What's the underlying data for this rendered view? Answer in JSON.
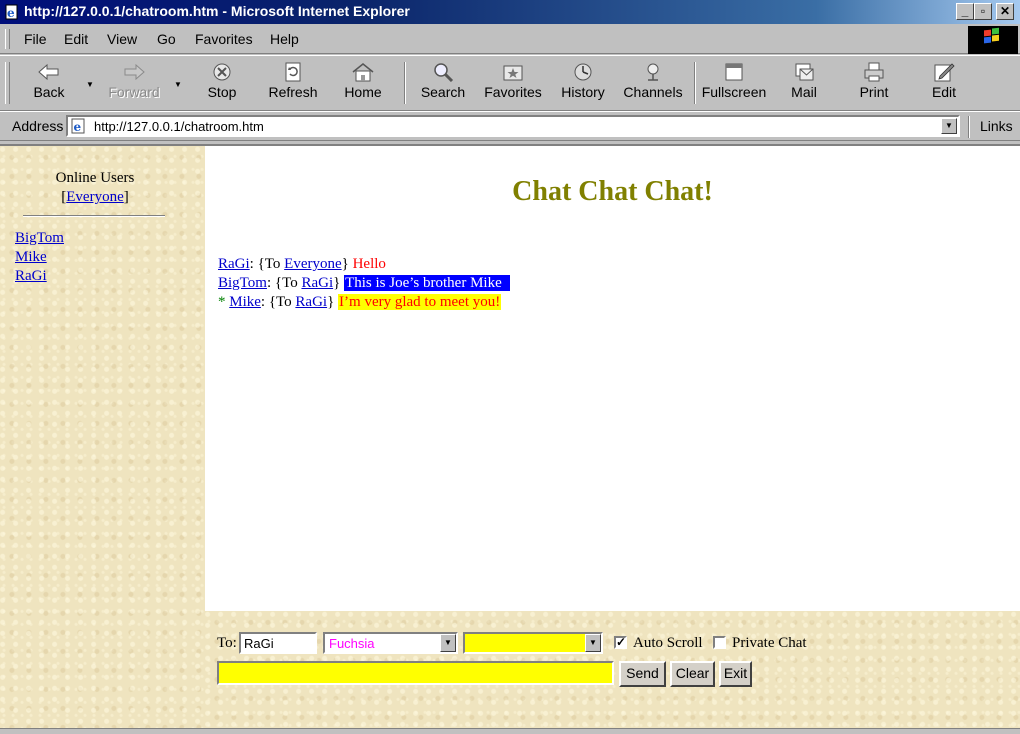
{
  "window": {
    "title": "http://127.0.0.1/chatroom.htm - Microsoft Internet Explorer",
    "controls": {
      "minimize": "_",
      "maximize": "▫",
      "close": "✕"
    }
  },
  "menu": {
    "items": [
      {
        "label": "File"
      },
      {
        "label": "Edit"
      },
      {
        "label": "View"
      },
      {
        "label": "Go"
      },
      {
        "label": "Favorites"
      },
      {
        "label": "Help"
      }
    ]
  },
  "toolbar": {
    "buttons": [
      {
        "label": "Back",
        "icon": "back-arrow-icon",
        "enabled": true
      },
      {
        "label": "Forward",
        "icon": "forward-arrow-icon",
        "enabled": false
      },
      {
        "label": "Stop",
        "icon": "stop-icon",
        "enabled": true
      },
      {
        "label": "Refresh",
        "icon": "refresh-icon",
        "enabled": true
      },
      {
        "label": "Home",
        "icon": "home-icon",
        "enabled": true
      },
      {
        "label": "Search",
        "icon": "search-icon",
        "enabled": true
      },
      {
        "label": "Favorites",
        "icon": "favorites-icon",
        "enabled": true
      },
      {
        "label": "History",
        "icon": "history-icon",
        "enabled": true
      },
      {
        "label": "Channels",
        "icon": "channels-icon",
        "enabled": true
      },
      {
        "label": "Fullscreen",
        "icon": "fullscreen-icon",
        "enabled": true
      },
      {
        "label": "Mail",
        "icon": "mail-icon",
        "enabled": true
      },
      {
        "label": "Print",
        "icon": "print-icon",
        "enabled": true
      },
      {
        "label": "Edit",
        "icon": "edit-icon",
        "enabled": true
      }
    ]
  },
  "address": {
    "label": "Address",
    "value": "http://127.0.0.1/chatroom.htm",
    "links_label": "Links"
  },
  "sidebar": {
    "title": "Online Users",
    "everyone_open": "[",
    "everyone_label": "Everyone",
    "everyone_close": "]",
    "users": [
      "BigTom",
      "Mike",
      "RaGi"
    ]
  },
  "chat": {
    "title": "Chat Chat Chat!",
    "messages": [
      {
        "prefix": "",
        "from": "RaGi",
        "to_open": ": {To ",
        "to": "Everyone",
        "to_close": "} ",
        "text": "Hello",
        "style": "red"
      },
      {
        "prefix": "",
        "from": "BigTom",
        "to_open": ": {To ",
        "to": "RaGi",
        "to_close": "} ",
        "text": "This is Joe’s brother Mike",
        "style": "blue-highlight"
      },
      {
        "prefix": "* ",
        "from": "Mike",
        "to_open": ": {To ",
        "to": "RaGi",
        "to_close": "} ",
        "text": "I’m very glad to meet you!",
        "style": "yellow-highlight"
      }
    ]
  },
  "controls": {
    "to_label": "To:",
    "to_value": "RaGi",
    "color_select": "Fuchsia",
    "color_select_color": "#ff00ff",
    "bgcolor_select": "",
    "bgcolor_select_color": "#ffff00",
    "auto_scroll_label": "Auto Scroll",
    "auto_scroll_checked": true,
    "private_chat_label": "Private Chat",
    "private_chat_checked": false,
    "message_value": "",
    "message_bg_color": "#ffff00",
    "send_label": "Send",
    "clear_label": "Clear",
    "exit_label": "Exit"
  }
}
